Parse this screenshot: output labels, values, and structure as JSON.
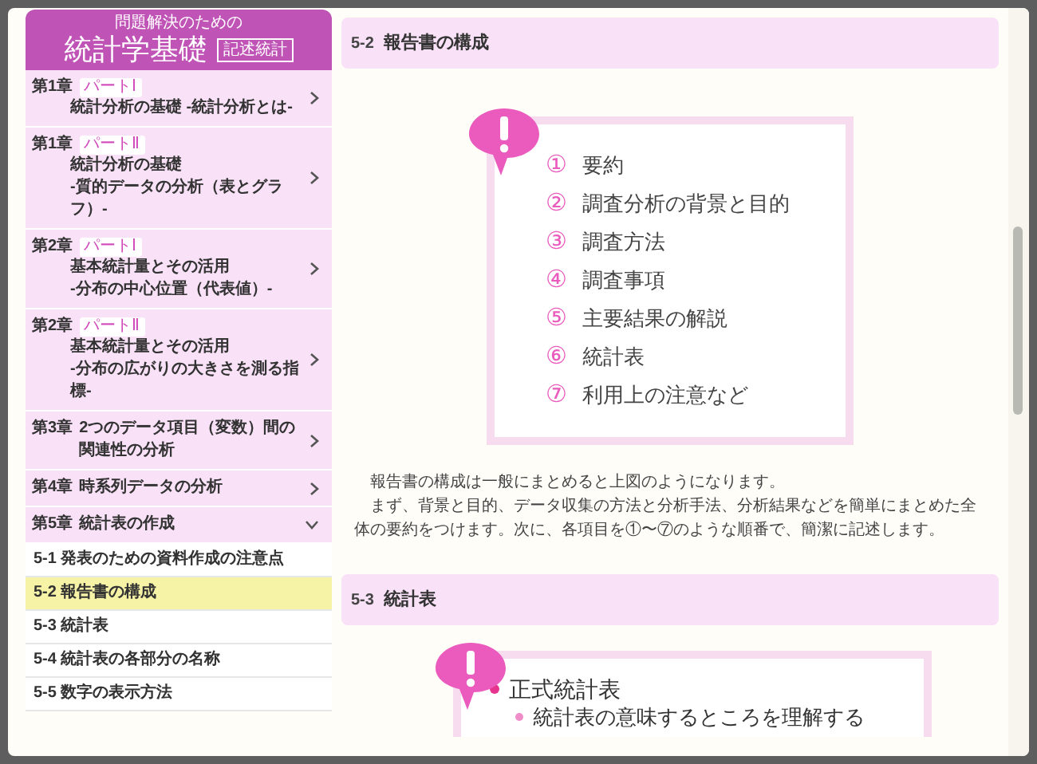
{
  "book_title": {
    "subtitle": "問題解決のための",
    "title": "統計学基礎",
    "badge": "記述統計"
  },
  "chapters": [
    {
      "number": "第1章",
      "part": "パートⅠ",
      "title_lines": [
        "統計分析の基礎 -統計分析とは-"
      ],
      "expanded": false
    },
    {
      "number": "第1章",
      "part": "パートⅡ",
      "title_lines": [
        "統計分析の基礎",
        "-質的データの分析（表とグラフ）-"
      ],
      "expanded": false
    },
    {
      "number": "第2章",
      "part": "パートⅠ",
      "title_lines": [
        "基本統計量とその活用",
        "-分布の中心位置（代表値）-"
      ],
      "expanded": false
    },
    {
      "number": "第2章",
      "part": "パートⅡ",
      "title_lines": [
        "基本統計量とその活用",
        "-分布の広がりの大きさを測る指標-"
      ],
      "expanded": false
    },
    {
      "number": "第3章",
      "title_lines": [
        "2つのデータ項目（変数）間の関連性の分析"
      ],
      "expanded": false
    },
    {
      "number": "第4章",
      "title_lines": [
        "時系列データの分析"
      ],
      "expanded": false
    },
    {
      "number": "第5章",
      "title_lines": [
        "統計表の作成"
      ],
      "expanded": true,
      "children": [
        {
          "label": "5-1 発表のための資料作成の注意点",
          "selected": false
        },
        {
          "label": "5-2 報告書の構成",
          "selected": true
        },
        {
          "label": "5-3 統計表",
          "selected": false
        },
        {
          "label": "5-4 統計表の各部分の名称",
          "selected": false
        },
        {
          "label": "5-5 数字の表示方法",
          "selected": false
        }
      ]
    }
  ],
  "sections": [
    {
      "number": "5-2",
      "title": "報告書の構成",
      "figure": {
        "kind": "numbered",
        "items": [
          {
            "marker": "①",
            "text": "要約"
          },
          {
            "marker": "②",
            "text": "調査分析の背景と目的"
          },
          {
            "marker": "③",
            "text": "調査方法"
          },
          {
            "marker": "④",
            "text": "調査事項"
          },
          {
            "marker": "⑤",
            "text": "主要結果の解説"
          },
          {
            "marker": "⑥",
            "text": "統計表"
          },
          {
            "marker": "⑦",
            "text": "利用上の注意など"
          }
        ]
      },
      "paragraphs": [
        "報告書の構成は一般にまとめると上図のようになります。",
        "まず、背景と目的、データ収集の方法と分析手法、分析結果などを簡単にまとめた全体の要約をつけます。次に、各項目を①〜⑦のような順番で、簡潔に記述します。"
      ]
    },
    {
      "number": "5-3",
      "title": "統計表",
      "figure": {
        "kind": "bulleted",
        "items": [
          {
            "text": "正式統計表",
            "children": [
              {
                "text": "統計表の意味するところを理解する"
              }
            ]
          }
        ]
      }
    }
  ]
}
